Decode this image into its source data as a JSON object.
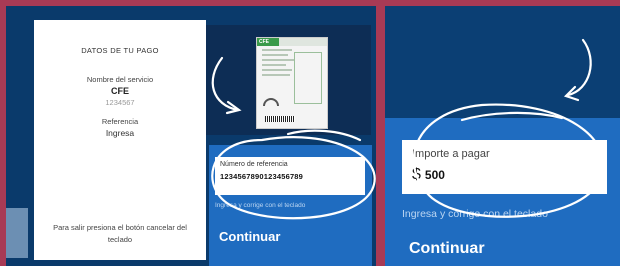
{
  "payment_card": {
    "title": "DATOS DE TU PAGO",
    "service_label": "Nombre del servicio",
    "service_name": "CFE",
    "service_code": "1234567",
    "reference_label": "Referencia",
    "reference_value": "Ingresa",
    "exit_hint": "Para salir presiona el botón cancelar del teclado"
  },
  "bill": {
    "logo_text": "CFE"
  },
  "reference_entry": {
    "label": "Número de referencia",
    "value": "123456789012345678​9",
    "hint": "Ingresa y corrige con el teclado",
    "continue_label": "Continuar"
  },
  "amount_entry": {
    "label": "Importe a pagar",
    "currency": "$",
    "value": "500",
    "hint": "Ingresa y corrige con el teclado",
    "continue_label": "Continuar"
  },
  "colors": {
    "frame": "#a83a55",
    "screen_dark": "#0a3a6b",
    "screen_accent": "#1f6cc0"
  }
}
